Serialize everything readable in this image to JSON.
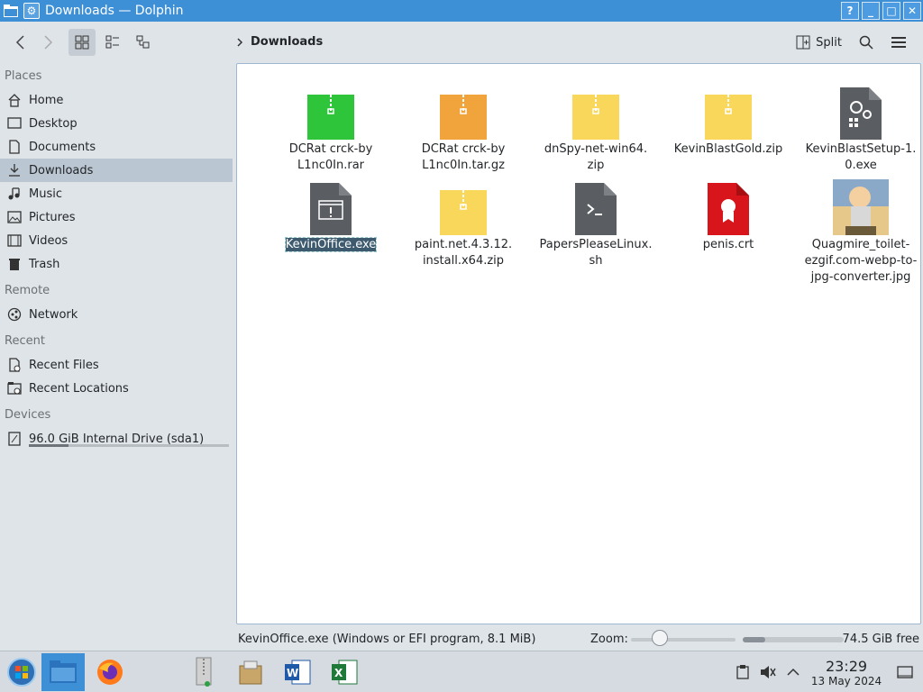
{
  "window": {
    "title": "Downloads — Dolphin",
    "buttons": [
      "?",
      "_",
      "□",
      "✕"
    ]
  },
  "toolbar": {
    "breadcrumb": "Downloads",
    "split_label": "Split"
  },
  "sidebar": {
    "sections": [
      {
        "title": "Places",
        "items": [
          {
            "label": "Home",
            "icon": "home-icon"
          },
          {
            "label": "Desktop",
            "icon": "desktop-icon"
          },
          {
            "label": "Documents",
            "icon": "documents-icon"
          },
          {
            "label": "Downloads",
            "icon": "downloads-icon",
            "active": true
          },
          {
            "label": "Music",
            "icon": "music-icon"
          },
          {
            "label": "Pictures",
            "icon": "pictures-icon"
          },
          {
            "label": "Videos",
            "icon": "videos-icon"
          },
          {
            "label": "Trash",
            "icon": "trash-icon"
          }
        ]
      },
      {
        "title": "Remote",
        "items": [
          {
            "label": "Network",
            "icon": "network-icon"
          }
        ]
      },
      {
        "title": "Recent",
        "items": [
          {
            "label": "Recent Files",
            "icon": "recent-files-icon"
          },
          {
            "label": "Recent Locations",
            "icon": "recent-locations-icon"
          }
        ]
      },
      {
        "title": "Devices",
        "items": [
          {
            "label": "96.0 GiB Internal Drive (sda1)",
            "icon": "drive-icon",
            "usage": 0.2
          }
        ]
      }
    ]
  },
  "files": [
    {
      "name": "DCRat crck-by L1nc0In.rar",
      "line1": "DCRat crck-by",
      "line2": "L1nc0In.rar",
      "line3": "",
      "type": "archive",
      "color": "#2ec53a"
    },
    {
      "name": "DCRat crck-by L1nc0In.tar.gz",
      "line1": "DCRat crck-by",
      "line2": "L1nc0In.tar.gz",
      "line3": "",
      "type": "archive",
      "color": "#f0a43b"
    },
    {
      "name": "dnSpy-net-win64.zip",
      "line1": "dnSpy-net-win64.",
      "line2": "zip",
      "line3": "",
      "type": "archive",
      "color": "#f8d75a"
    },
    {
      "name": "KevinBlastGold.zip",
      "line1": "KevinBlastGold.zip",
      "line2": "",
      "line3": "",
      "type": "archive",
      "color": "#f8d75a"
    },
    {
      "name": "KevinBlastSetup-1.0.exe",
      "line1": "KevinBlastSetup-1.",
      "line2": "0.exe",
      "line3": "",
      "type": "setup",
      "color": "#5a5e62"
    },
    {
      "name": "KevinOffice.exe",
      "line1": "KevinOffice.exe",
      "line2": "",
      "line3": "",
      "type": "exe",
      "color": "#5a5e62",
      "selected": true
    },
    {
      "name": "paint.net.4.3.12.install.x64.zip",
      "line1": "paint.net.4.3.12.",
      "line2": "install.x64.zip",
      "line3": "",
      "type": "archive",
      "color": "#f8d75a"
    },
    {
      "name": "PapersPleaseLinux.sh",
      "line1": "PapersPleaseLinux.",
      "line2": "sh",
      "line3": "",
      "type": "script",
      "color": "#5a5e62"
    },
    {
      "name": "penis.crt",
      "line1": "penis.crt",
      "line2": "",
      "line3": "",
      "type": "cert",
      "color": "#d7151b"
    },
    {
      "name": "Quagmire_toilet-ezgif.com-webp-to-jpg-converter.jpg",
      "line1": "Quagmire_toilet-",
      "line2": "ezgif.com-webp-to-",
      "line3": "jpg-converter.jpg",
      "type": "image",
      "color": "#c8a06a"
    }
  ],
  "statusbar": {
    "info": "KevinOffice.exe (Windows or EFI program, 8.1 MiB)",
    "zoom_label": "Zoom:",
    "free_space": "74.5 GiB free",
    "used_fraction": 0.22
  },
  "taskbar": {
    "time": "23:29",
    "date": "13 May 2024",
    "apps": [
      "start-orb-icon",
      "dolphin-icon",
      "firefox-icon",
      "archive-manager-icon",
      "package-installer-icon",
      "word-icon",
      "excel-icon"
    ]
  }
}
